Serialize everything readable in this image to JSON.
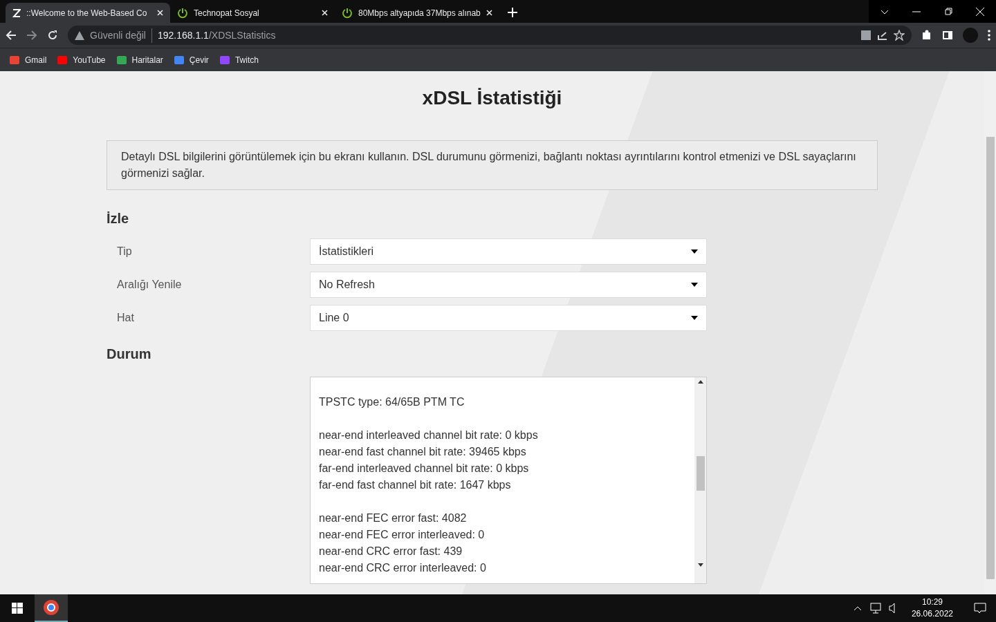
{
  "browser": {
    "tabs": [
      {
        "title": "::Welcome to the Web-Based Co",
        "selected": true
      },
      {
        "title": "Technopat Sosyal",
        "selected": false
      },
      {
        "title": "80Mbps altyapıda 37Mbps alınab",
        "selected": false
      }
    ],
    "address": {
      "security": "Güvenli değil",
      "host": "192.168.1.1",
      "path": "/XDSLStatistics"
    },
    "bookmarks": [
      {
        "label": "Gmail",
        "color": "#ea4335"
      },
      {
        "label": "YouTube",
        "color": "#ff0000"
      },
      {
        "label": "Haritalar",
        "color": "#34a853"
      },
      {
        "label": "Çevir",
        "color": "#4285f4"
      },
      {
        "label": "Twitch",
        "color": "#9146ff"
      }
    ]
  },
  "page": {
    "title": "xDSL İstatistiği",
    "info": "Detaylı DSL bilgilerini görüntülemek için bu ekranı kullanın. DSL durumunu görmenizi, bağlantı noktası ayrıntılarını kontrol etmenizi ve DSL sayaçlarını görmenizi sağlar.",
    "monitor": {
      "heading": "İzle",
      "fields": [
        {
          "label": "Tip",
          "value": "İstatistikleri"
        },
        {
          "label": "Aralığı Yenile",
          "value": "No Refresh"
        },
        {
          "label": "Hat",
          "value": "Line 0"
        }
      ]
    },
    "status": {
      "heading": "Durum",
      "groups": [
        [
          "TPSTC type: 64/65B PTM TC"
        ],
        [
          "near-end interleaved channel bit rate: 0 kbps",
          "near-end fast channel bit rate: 39465 kbps",
          "far-end interleaved channel bit rate: 0 kbps",
          "far-end fast channel bit rate: 1647 kbps"
        ],
        [
          "near-end FEC error fast: 4082",
          "near-end FEC error interleaved: 0",
          "near-end CRC error fast: 439",
          "near-end CRC error interleaved: 0"
        ]
      ]
    }
  },
  "taskbar": {
    "time": "10:29",
    "date": "26.06.2022"
  }
}
